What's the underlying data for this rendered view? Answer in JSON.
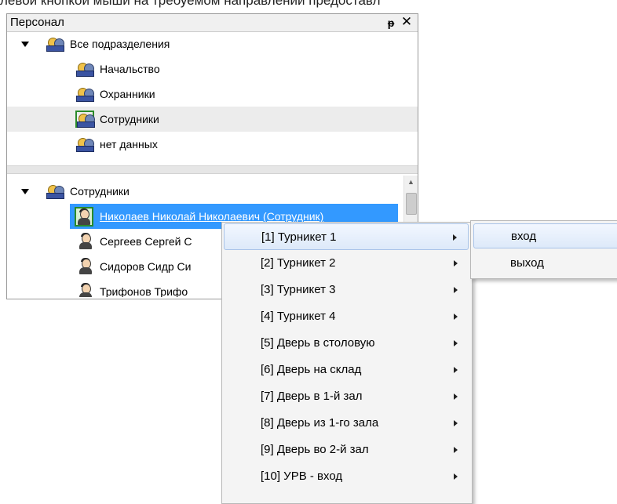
{
  "top_text": "левой кнопкой мыши на требуемом направлении предоставл",
  "panel": {
    "title": "Персонал",
    "pin_icon": "pin-icon",
    "close_icon": "close-icon",
    "groups_tree": {
      "root": "Все подразделения",
      "children": [
        "Начальство",
        "Охранники",
        "Сотрудники",
        "нет данных"
      ],
      "highlighted": "Сотрудники"
    },
    "staff_tree": {
      "root": "Сотрудники",
      "people": [
        "Николаев Николай Николаевич (Сотрудник)",
        "Сергеев Сергей С",
        "Сидоров Сидр Си",
        "Трифонов Трифо"
      ],
      "selected": "Николаев Николай Николаевич (Сотрудник)"
    }
  },
  "context_menu": {
    "items": [
      "[1] Турникет 1",
      "[2] Турникет 2",
      "[3] Турникет 3",
      "[4] Турникет 4",
      "[5] Дверь в столовую",
      "[6] Дверь на склад",
      "[7] Дверь в 1-й зал",
      "[8] Дверь из 1-го зала",
      "[9] Дверь во 2-й зал",
      "[10] УРВ - вход"
    ],
    "active_index": 0
  },
  "submenu": {
    "items": [
      "вход",
      "выход"
    ],
    "active_index": 0
  }
}
